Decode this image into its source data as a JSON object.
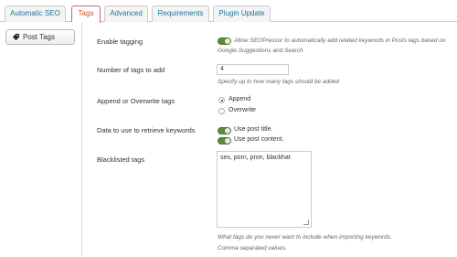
{
  "tabs": [
    {
      "label": "Automatic SEO"
    },
    {
      "label": "Tags",
      "active": true
    },
    {
      "label": "Advanced"
    },
    {
      "label": "Requirements"
    },
    {
      "label": "Plugin Update"
    }
  ],
  "sidebar": {
    "post_tags_label": "Post Tags"
  },
  "settings": {
    "enable_tagging": {
      "label": "Enable tagging",
      "enabled": true,
      "description_line1": "Allow SEOPressor to automatically add related keywords in Posts tags based on",
      "description_line2": "Google Suggestions and Search"
    },
    "num_tags": {
      "label": "Number of tags to add",
      "value": "4",
      "help": "Specify up to how many tags should be added"
    },
    "append_overwrite": {
      "label": "Append or Overwrite tags",
      "options": [
        "Append",
        "Overwrite"
      ],
      "selected": "Append"
    },
    "data_source": {
      "label": "Data to use to retrieve keywords",
      "use_post_title": "Use post title.",
      "use_post_content": "Use post content."
    },
    "blacklist": {
      "label": "Blacklisted tags",
      "value": "sex, porn, pron, blackhat",
      "help_line1": "What tags do you never want to include when importing keywords.",
      "help_line2": "Comma separated values."
    }
  },
  "colors": {
    "accent": "#d54e21",
    "link": "#21759b",
    "toggle_on": "#5a8a3a"
  }
}
